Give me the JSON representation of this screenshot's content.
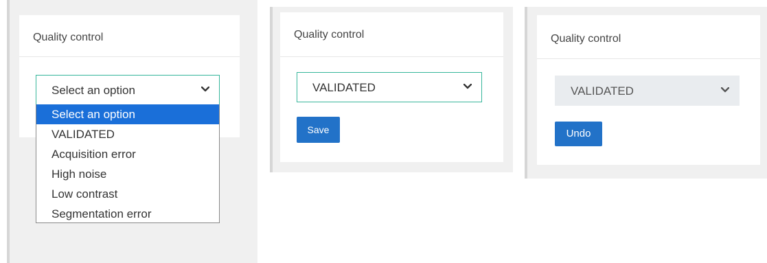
{
  "panel1": {
    "title": "Quality control",
    "select": {
      "value": "Select an option"
    },
    "options": [
      "Select an option",
      "VALIDATED",
      "Acquisition error",
      "High noise",
      "Low contrast",
      "Segmentation error"
    ],
    "selected_index": 0
  },
  "panel2": {
    "title": "Quality control",
    "select": {
      "value": "VALIDATED"
    },
    "save_label": "Save"
  },
  "panel3": {
    "title": "Quality control",
    "select": {
      "value": "VALIDATED"
    },
    "undo_label": "Undo"
  },
  "icons": {
    "select_arrow": "chevron-down-icon"
  },
  "colors": {
    "focus_border": "#34b59a",
    "accent": "#2272c8",
    "option_highlight": "#1a6fd9",
    "disabled_bg": "#e9ecef"
  }
}
